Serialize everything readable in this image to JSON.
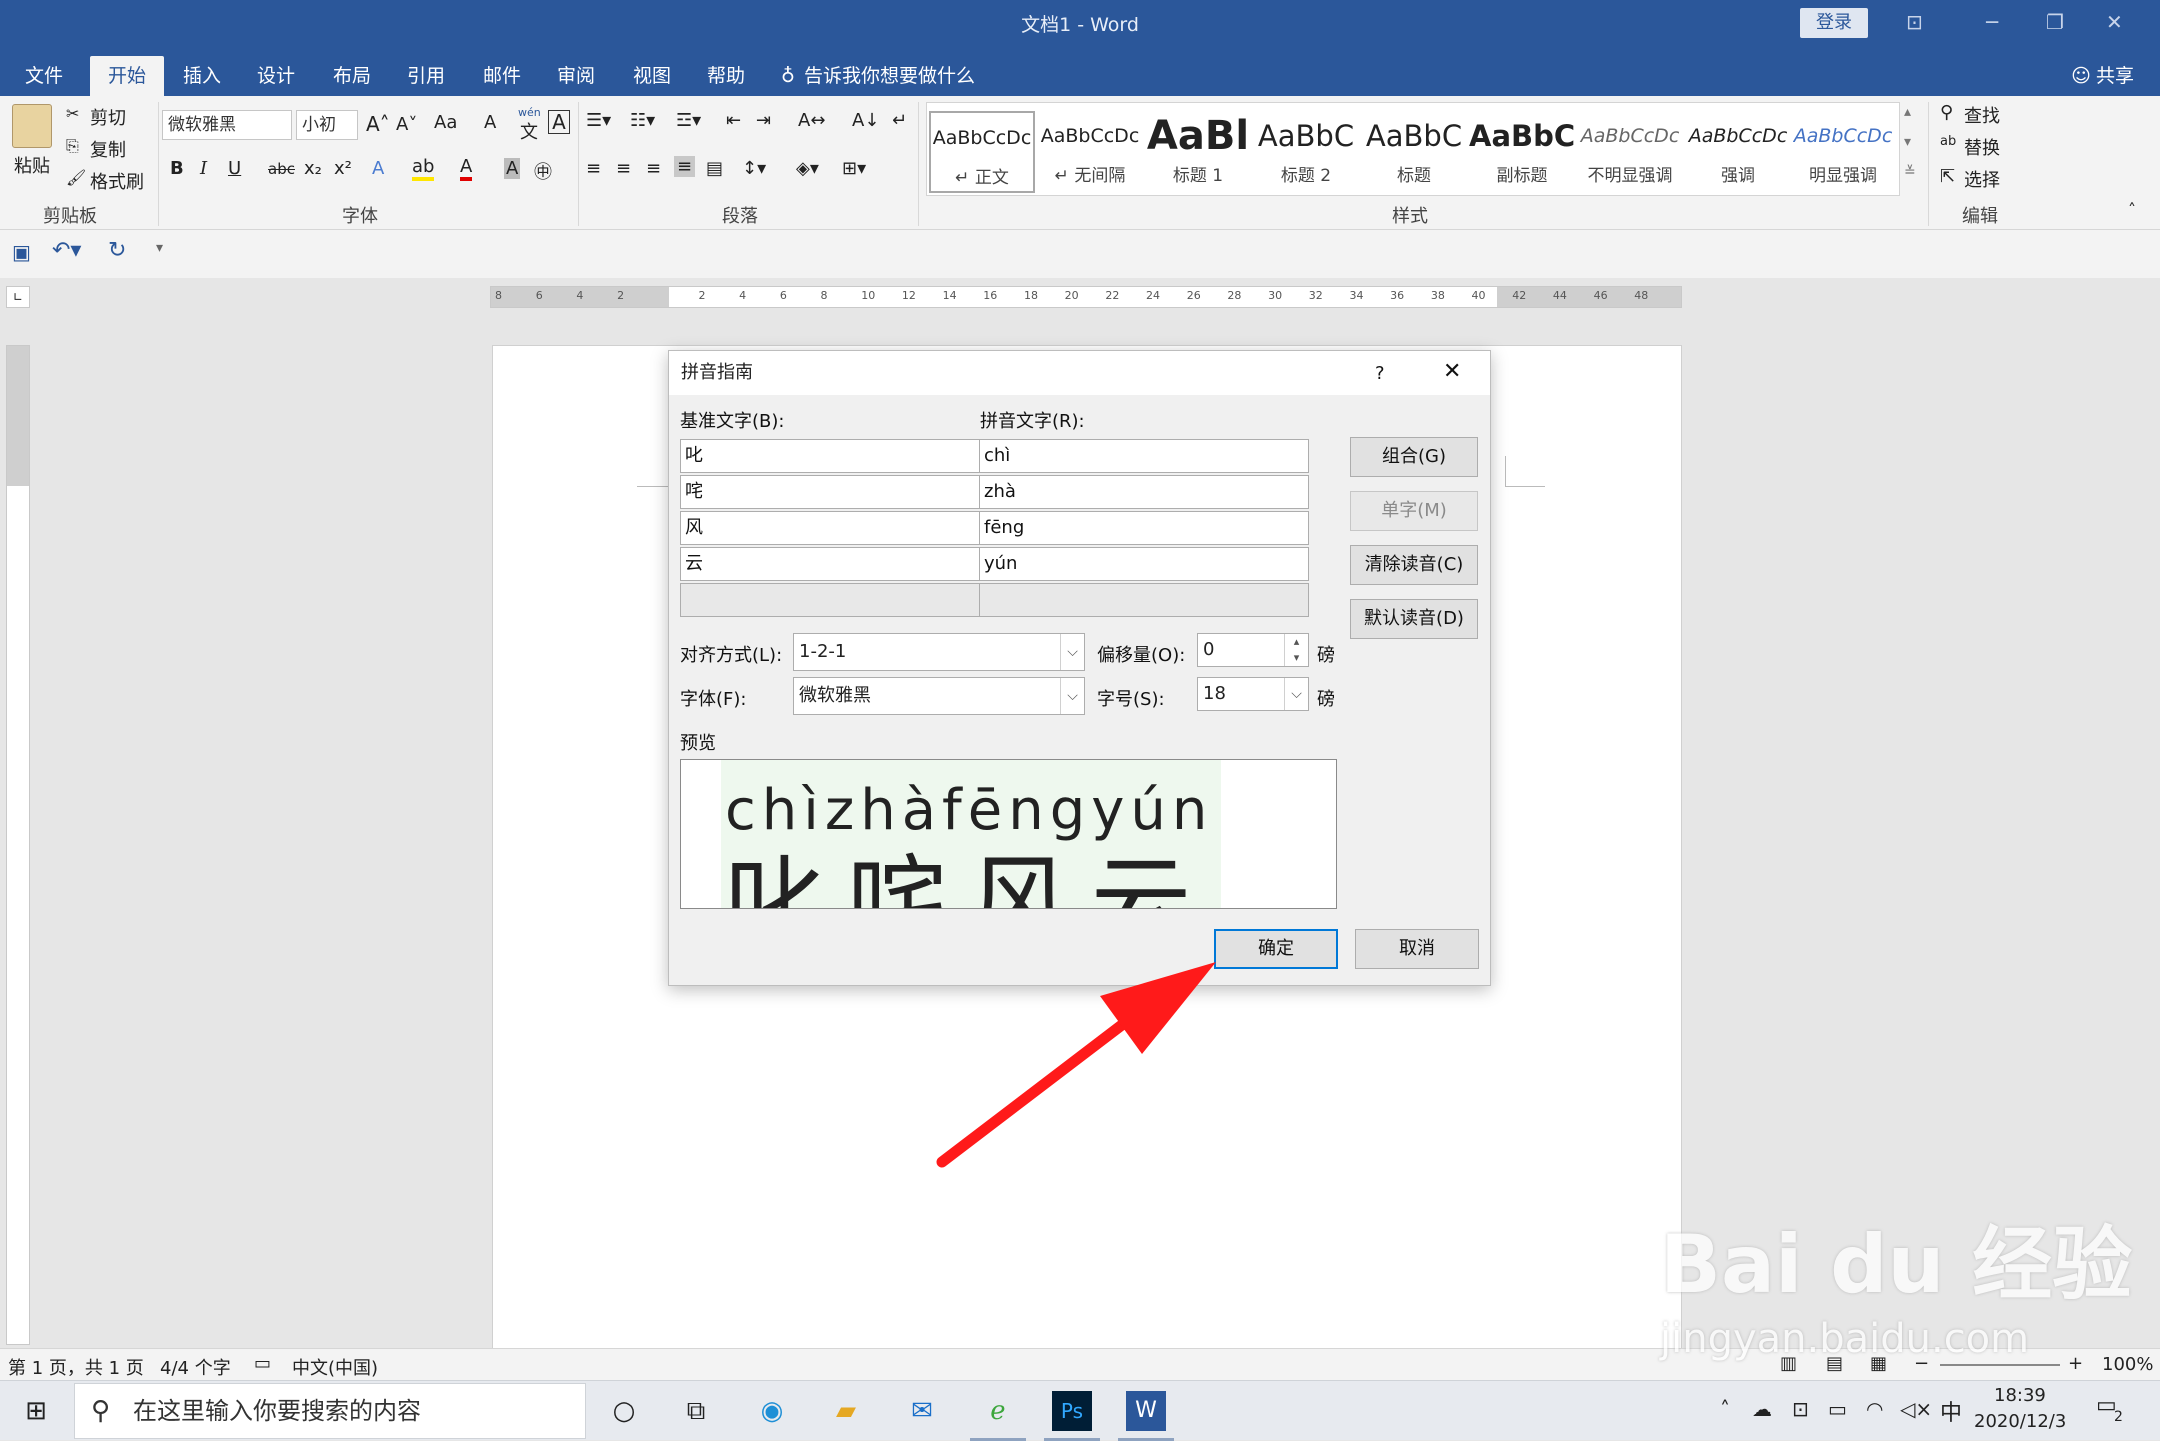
{
  "window": {
    "title": "文档1  -  Word",
    "login": "登录"
  },
  "tabs": [
    {
      "label": "文件"
    },
    {
      "label": "开始"
    },
    {
      "label": "插入"
    },
    {
      "label": "设计"
    },
    {
      "label": "布局"
    },
    {
      "label": "引用"
    },
    {
      "label": "邮件"
    },
    {
      "label": "审阅"
    },
    {
      "label": "视图"
    },
    {
      "label": "帮助"
    }
  ],
  "tell_me": "告诉我你想要做什么",
  "share": "共享",
  "clipboard": {
    "paste": "粘贴",
    "cut": "剪切",
    "copy": "复制",
    "format_painter": "格式刷",
    "label": "剪贴板"
  },
  "font": {
    "name": "微软雅黑",
    "size": "小初",
    "label": "字体",
    "change_case": "Aa",
    "phonetic_top": "wén",
    "phonetic_bottom": "文"
  },
  "paragraph": {
    "label": "段落"
  },
  "styles": {
    "label": "样式",
    "items": [
      {
        "preview": "AaBbCcDc",
        "name": "↵ 正文"
      },
      {
        "preview": "AaBbCcDc",
        "name": "↵ 无间隔"
      },
      {
        "preview": "AaBl",
        "name": "标题 1"
      },
      {
        "preview": "AaBbC",
        "name": "标题 2"
      },
      {
        "preview": "AaBbC",
        "name": "标题"
      },
      {
        "preview": "AaBbC",
        "name": "副标题"
      },
      {
        "preview": "AaBbCcDc",
        "name": "不明显强调"
      },
      {
        "preview": "AaBbCcDc",
        "name": "强调"
      },
      {
        "preview": "AaBbCcDc",
        "name": "明显强调"
      }
    ]
  },
  "editing": {
    "find": "查找",
    "replace": "替换",
    "select": "选择",
    "label": "编辑"
  },
  "ruler": {
    "ticks": [
      "8",
      "6",
      "4",
      "2",
      "",
      "2",
      "4",
      "6",
      "8",
      "10",
      "12",
      "14",
      "16",
      "18",
      "20",
      "22",
      "24",
      "26",
      "28",
      "30",
      "32",
      "34",
      "36",
      "38",
      "40",
      "42",
      "44",
      "46",
      "48"
    ]
  },
  "dialog": {
    "title": "拼音指南",
    "help": "?",
    "base_label": "基准文字(B):",
    "ruby_label": "拼音文字(R):",
    "rows": [
      {
        "base": "叱",
        "ruby": "chì"
      },
      {
        "base": "咤",
        "ruby": "zhà"
      },
      {
        "base": "风",
        "ruby": "fēng"
      },
      {
        "base": "云",
        "ruby": "yún"
      }
    ],
    "buttons": {
      "group": "组合(G)",
      "mono": "单字(M)",
      "clear": "清除读音(C)",
      "default": "默认读音(D)",
      "ok": "确定",
      "cancel": "取消"
    },
    "align_label": "对齐方式(L):",
    "align_value": "1-2-1",
    "offset_label": "偏移量(O):",
    "offset_value": "0",
    "offset_unit": "磅",
    "font_label": "字体(F):",
    "font_value": "微软雅黑",
    "size_label": "字号(S):",
    "size_value": "18",
    "size_unit": "磅",
    "preview_label": "预览",
    "preview_pinyin": "chìzhàfēngyún",
    "preview_hanzi": "叱咤风云"
  },
  "status": {
    "page": "第 1 页，共 1 页",
    "words": "4/4 个字",
    "lang": "中文(中国)",
    "zoom": "100%"
  },
  "taskbar": {
    "search": "在这里输入你要搜索的内容",
    "time": "18:39",
    "date": "2020/12/3",
    "ime": "中",
    "notif": "2"
  },
  "watermark": {
    "brand": "Bai du 经验",
    "url": "jingyan.baidu.com"
  },
  "colors": {
    "word_blue": "#2b579a",
    "arrow": "#ff1a1a",
    "primary_border": "#0078d7"
  }
}
